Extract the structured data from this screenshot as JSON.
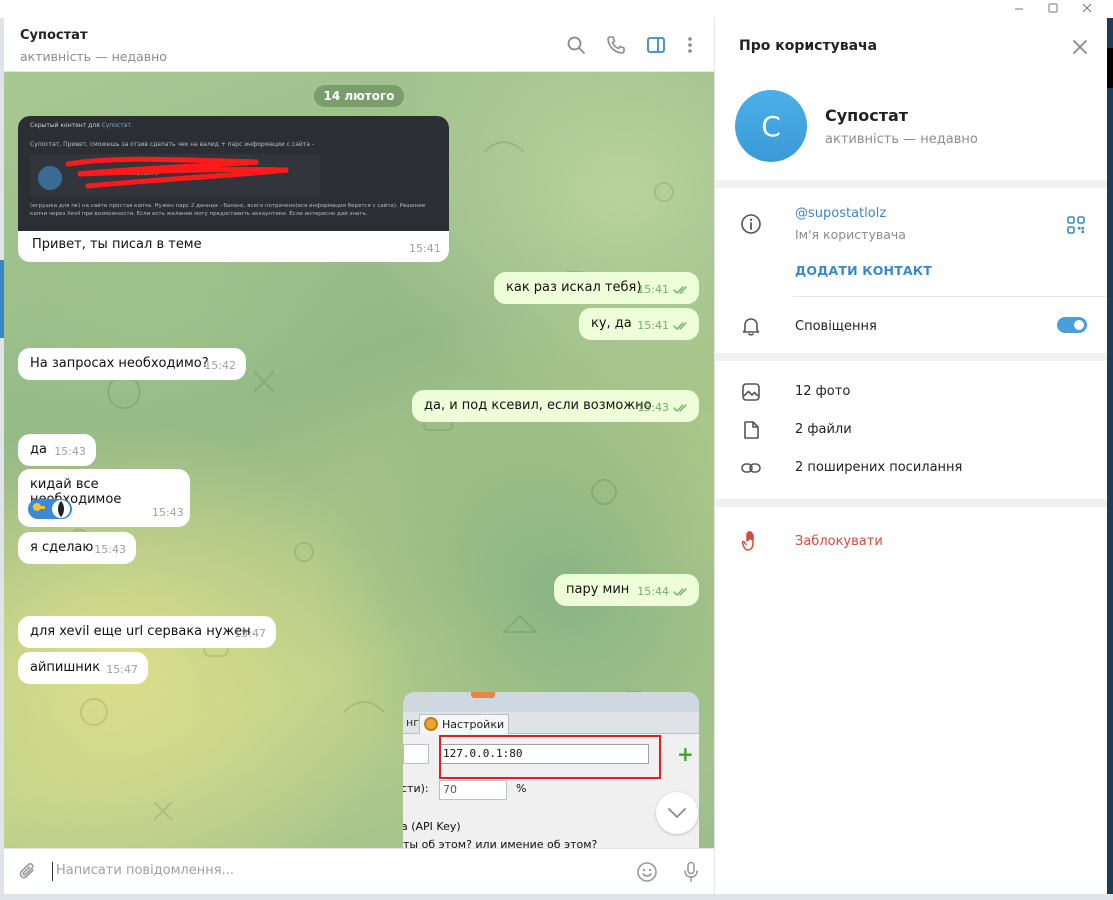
{
  "chat": {
    "title": "Супостат",
    "status": "активність — недавно",
    "date_separator": "14 лютого"
  },
  "messages": [
    {
      "id": "m1",
      "direction": "in",
      "text": "Привет, ты писал в теме",
      "time": "15:41",
      "embedded_preview": {
        "line1_prefix": "Скрытый контент для",
        "line1_name": "Супостат.",
        "line2": "Супостат, Привет, сможешь за отзив сделать чек на валид + парс информации с сайта -",
        "profile_line": "Новичок Регистрация 3",
        "body": "(игрушка для пк) на сайте простая капча. Нужен парс 2 данных - баланс, всего потрачено(вся информация берется с сайта). Решение капчи через Xevil при возможности. Если есть желание могу предоставить аккаунтики. Если интересно дай знать."
      }
    },
    {
      "id": "m2",
      "direction": "out",
      "text": "как раз искал тебя)",
      "time": "15:41"
    },
    {
      "id": "m3",
      "direction": "out",
      "text": "ку, да",
      "time": "15:41"
    },
    {
      "id": "m4",
      "direction": "in",
      "text": "На запросах необходимо?",
      "time": "15:42"
    },
    {
      "id": "m5",
      "direction": "out",
      "text": "да, и под ксевил, если возможно",
      "time": "15:43"
    },
    {
      "id": "m6",
      "direction": "in",
      "text": "да",
      "time": "15:43"
    },
    {
      "id": "m7",
      "direction": "in",
      "text": "кидай все необходимое",
      "time": "15:43"
    },
    {
      "id": "m8",
      "direction": "in",
      "text": "я сделаю",
      "time": "15:43"
    },
    {
      "id": "m9",
      "direction": "out",
      "text": "пару мин",
      "time": "15:44"
    },
    {
      "id": "m10",
      "direction": "in",
      "text": "для xevil еще url сервака нужен",
      "time": "15:47"
    },
    {
      "id": "m11",
      "direction": "in",
      "text": "айпишник",
      "time": "15:47"
    }
  ],
  "photo_message": {
    "tab_partial": "нг",
    "tab_settings": "Настройки",
    "ip_field": "127.0.0.1:80",
    "label_partial": "сти):",
    "percent_value": "70",
    "percent_sign": "%",
    "api_key_label": "а (API Key)",
    "caption_partial": "ты об этом? или имение об этом?"
  },
  "composer": {
    "placeholder": "Написати повідомлення..."
  },
  "panel": {
    "title": "Про користувача",
    "avatar_letter": "С",
    "name": "Супостат",
    "status": "активність — недавно",
    "username": "@supostatlolz",
    "username_label": "Ім'я користувача",
    "add_contact": "ДОДАТИ КОНТАКТ",
    "notifications": "Сповіщення",
    "notifications_enabled": true,
    "media": [
      {
        "icon": "photo-icon",
        "label": "12 фото"
      },
      {
        "icon": "file-icon",
        "label": "2 файли"
      },
      {
        "icon": "link-icon",
        "label": "2 поширених посилання"
      }
    ],
    "block": "Заблокувати"
  },
  "colors": {
    "accent": "#3a88c8",
    "outgoing_bubble": "#eefed8",
    "incoming_bubble": "#ffffff",
    "danger": "#d64a3e"
  }
}
